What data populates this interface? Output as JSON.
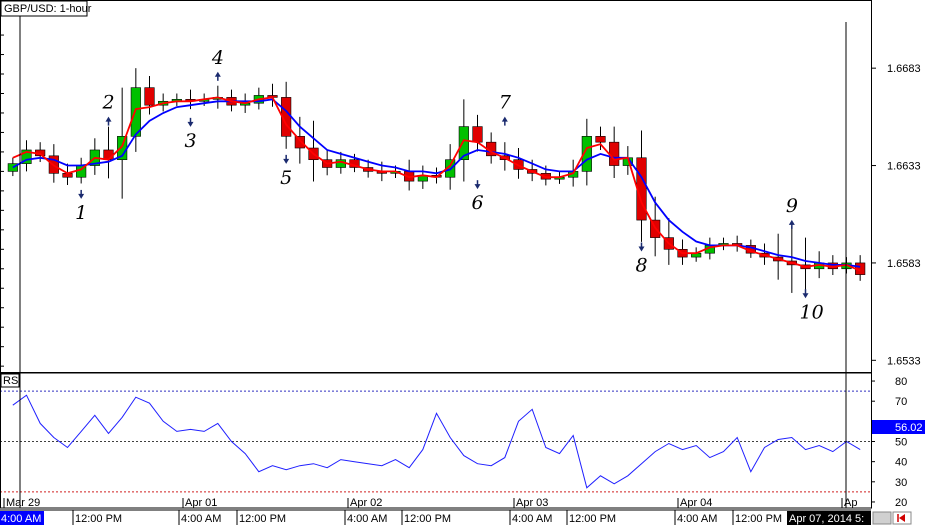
{
  "header": {
    "symbol_title": "GBP/USD: 1-hour"
  },
  "rsi_panel": {
    "label": "RSI",
    "current_value": "56.02"
  },
  "bottom_bar": {
    "left_time": "4:00 AM",
    "right_stamp": "Apr 07, 2014 5:"
  },
  "colors": {
    "bull": "#00c000",
    "bear": "#e00000",
    "fast_ma": "#ff0000",
    "slow_ma": "#0000ff",
    "rsi_line": "#2020ff",
    "rsi_badge": "#0000ff",
    "arrow": "#1a2a6e"
  },
  "chart_data": [
    {
      "type": "candlestick",
      "title": "GBP/USD: 1-hour",
      "y_ticks": [
        "1.6683",
        "1.6633",
        "1.6583",
        "1.6533"
      ],
      "ylim": [
        1.6527,
        1.6718
      ],
      "x_date_labels": [
        "Mar 29",
        "Apr 01",
        "Apr 02",
        "Apr 03",
        "Apr 04",
        "Ap"
      ],
      "x_time_labels": [
        "4:00 AM",
        "12:00 PM",
        "4:00 AM",
        "12:00 PM",
        "4:00 AM",
        "12:00 PM",
        "4:00 AM",
        "12:00 PM",
        "4:00 AM",
        "12:00 PM"
      ],
      "series": [
        {
          "kind": "ohlc",
          "close": [
            1.6634,
            1.6641,
            1.6638,
            1.6629,
            1.6627,
            1.6633,
            1.6641,
            1.6636,
            1.6648,
            1.6673,
            1.6664,
            1.6666,
            1.6667,
            1.6666,
            1.6667,
            1.6668,
            1.6664,
            1.6665,
            1.6669,
            1.6668,
            1.6648,
            1.6642,
            1.6636,
            1.6632,
            1.6636,
            1.6632,
            1.663,
            1.6629,
            1.663,
            1.6625,
            1.6628,
            1.6627,
            1.6636,
            1.6653,
            1.6645,
            1.6638,
            1.6636,
            1.6631,
            1.6629,
            1.6626,
            1.6627,
            1.663,
            1.6648,
            1.6645,
            1.6633,
            1.6637,
            1.6605,
            1.6596,
            1.659,
            1.6586,
            1.6588,
            1.6592,
            1.6593,
            1.6592,
            1.6588,
            1.6586,
            1.6584,
            1.6582,
            1.658,
            1.6583,
            1.658,
            1.6583,
            1.6577
          ]
        },
        {
          "name": "",
          "kind": "moving_average",
          "values": [
            1.6637,
            1.664,
            1.6639,
            1.6633,
            1.6629,
            1.6631,
            1.6637,
            1.6636,
            1.6643,
            1.6662,
            1.6663,
            1.6665,
            1.6666,
            1.6666,
            1.6667,
            1.6668,
            1.6666,
            1.6665,
            1.6667,
            1.6668,
            1.6654,
            1.6646,
            1.6639,
            1.6634,
            1.6635,
            1.6633,
            1.6631,
            1.663,
            1.663,
            1.6627,
            1.6628,
            1.6627,
            1.6633,
            1.6646,
            1.6645,
            1.664,
            1.6637,
            1.6633,
            1.663,
            1.6627,
            1.6627,
            1.6629,
            1.6642,
            1.6644,
            1.6636,
            1.6637,
            1.6614,
            1.6601,
            1.6593,
            1.6588,
            1.6588,
            1.6591,
            1.6592,
            1.6592,
            1.6589,
            1.6587,
            1.6585,
            1.6583,
            1.6581,
            1.6582,
            1.6581,
            1.6582,
            1.6579
          ]
        },
        {
          "name": "",
          "kind": "moving_average",
          "values": [
            1.6632,
            1.6636,
            1.6637,
            1.6636,
            1.6633,
            1.6633,
            1.6634,
            1.6635,
            1.6638,
            1.6649,
            1.6656,
            1.666,
            1.6663,
            1.6664,
            1.6665,
            1.6666,
            1.6666,
            1.6666,
            1.6666,
            1.6667,
            1.6661,
            1.6653,
            1.6647,
            1.6641,
            1.6639,
            1.6637,
            1.6635,
            1.6633,
            1.6632,
            1.663,
            1.663,
            1.6629,
            1.6631,
            1.6638,
            1.6641,
            1.664,
            1.6639,
            1.6637,
            1.6634,
            1.6631,
            1.663,
            1.663,
            1.6636,
            1.6639,
            1.6637,
            1.6637,
            1.6627,
            1.6614,
            1.6605,
            1.6599,
            1.6594,
            1.6592,
            1.6592,
            1.6592,
            1.6591,
            1.6589,
            1.6587,
            1.6586,
            1.6584,
            1.6583,
            1.6582,
            1.6582,
            1.6581
          ]
        }
      ],
      "annotations": [
        {
          "label": "1",
          "x_index": 5,
          "direction": "down",
          "price": 1.6621
        },
        {
          "label": "2",
          "x_index": 7,
          "direction": "up",
          "price": 1.6653
        },
        {
          "label": "3",
          "x_index": 13,
          "direction": "down",
          "price": 1.6658
        },
        {
          "label": "4",
          "x_index": 15,
          "direction": "up",
          "price": 1.6676
        },
        {
          "label": "5",
          "x_index": 20,
          "direction": "down",
          "price": 1.6639
        },
        {
          "label": "6",
          "x_index": 34,
          "direction": "down",
          "price": 1.6626
        },
        {
          "label": "7",
          "x_index": 36,
          "direction": "up",
          "price": 1.6653
        },
        {
          "label": "8",
          "x_index": 46,
          "direction": "down",
          "price": 1.6594
        },
        {
          "label": "9",
          "x_index": 57,
          "direction": "up",
          "price": 1.66
        },
        {
          "label": "10",
          "x_index": 58,
          "direction": "down",
          "price": 1.657
        }
      ]
    },
    {
      "type": "line",
      "title": "RSI",
      "y_ticks": [
        "80",
        "70",
        "50",
        "40",
        "30",
        "20"
      ],
      "ylim": [
        17,
        83
      ],
      "reference_levels": [
        75,
        50,
        25
      ],
      "series": [
        {
          "name": "",
          "values": [
            68,
            73,
            59,
            52,
            47,
            55,
            63,
            54,
            62,
            72,
            69,
            60,
            55,
            56,
            55,
            59,
            50,
            44,
            35,
            38,
            36,
            38,
            39,
            37,
            41,
            40,
            39,
            38,
            41,
            37,
            46,
            64,
            52,
            43,
            39,
            38,
            42,
            60,
            66,
            47,
            44,
            53,
            27,
            33,
            29,
            33,
            39,
            45,
            49,
            46,
            48,
            42,
            45,
            52,
            35,
            47,
            51,
            52,
            46,
            48,
            45,
            50,
            46
          ]
        }
      ],
      "current_value": 56.02
    }
  ]
}
